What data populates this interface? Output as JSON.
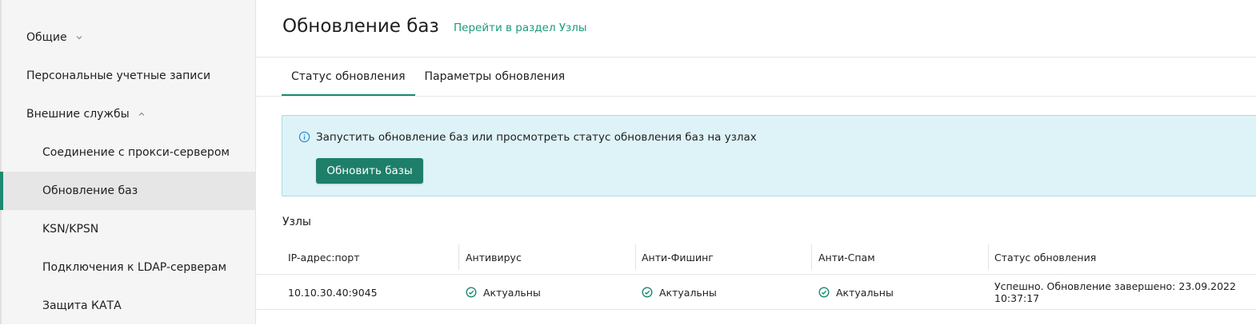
{
  "sidebar": {
    "items": [
      {
        "label": "Общие",
        "level": 0,
        "chevron": "chevron-down"
      },
      {
        "label": "Персональные учетные записи",
        "level": 0
      },
      {
        "label": "Внешние службы",
        "level": 0,
        "chevron": "chevron-up"
      },
      {
        "label": "Соединение с прокси-сервером",
        "level": 1
      },
      {
        "label": "Обновление баз",
        "level": 1,
        "active": true
      },
      {
        "label": "KSN/KPSN",
        "level": 1
      },
      {
        "label": "Подключения к LDAP-серверам",
        "level": 1
      },
      {
        "label": "Защита КАТА",
        "level": 1
      }
    ]
  },
  "header": {
    "title": "Обновление баз",
    "link": "Перейти в раздел Узлы"
  },
  "tabs": [
    {
      "label": "Статус обновления",
      "active": true
    },
    {
      "label": "Параметры обновления",
      "active": false
    }
  ],
  "info": {
    "icon": "info-circle-icon",
    "text": "Запустить обновление баз или просмотреть статус обновления баз на узлах",
    "button": "Обновить базы"
  },
  "nodes": {
    "title": "Узлы",
    "columns": [
      "IP-адрес:порт",
      "Антивирус",
      "Анти-Фишинг",
      "Анти-Спам",
      "Статус обновления"
    ],
    "rows": [
      {
        "address": "10.10.30.40:9045",
        "antivirus": "Актуальны",
        "antiphishing": "Актуальны",
        "antispam": "Актуальны",
        "status": "Успешно. Обновление завершено: 23.09.2022 10:37:17"
      }
    ]
  },
  "colors": {
    "accent": "#1b8a70",
    "link": "#1b9a7a",
    "info_bg": "#def3f8",
    "button_bg": "#1d7f69"
  }
}
